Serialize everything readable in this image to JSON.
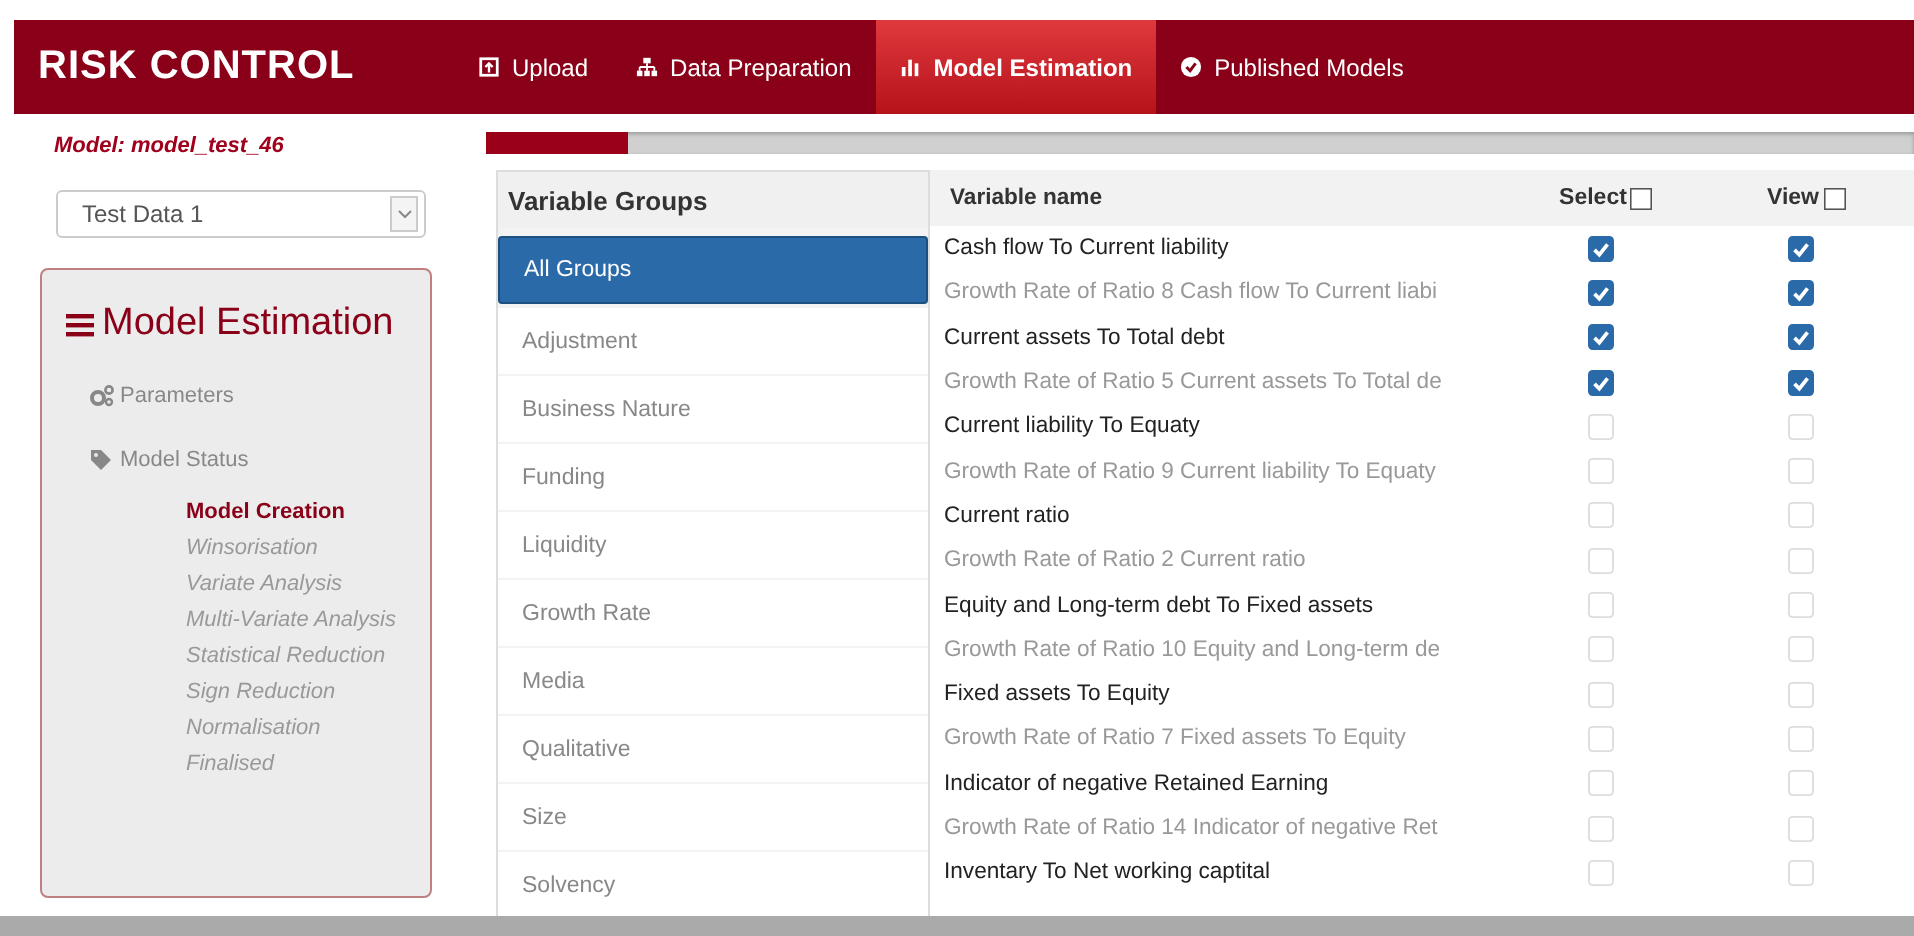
{
  "app_title": "RISK CONTROL",
  "nav": [
    {
      "label": "Upload",
      "selected": false
    },
    {
      "label": "Data Preparation",
      "selected": false
    },
    {
      "label": "Model Estimation",
      "selected": true
    },
    {
      "label": "Published Models",
      "selected": false
    }
  ],
  "model_label": "Model: model_test_46",
  "dataset_select": {
    "value": "Test Data 1"
  },
  "side_panel": {
    "title": "Model Estimation",
    "links": [
      {
        "label": "Parameters"
      },
      {
        "label": "Model Status"
      }
    ],
    "steps": [
      {
        "label": "Model Creation",
        "selected": true
      },
      {
        "label": "Winsorisation",
        "selected": false
      },
      {
        "label": "Variate Analysis",
        "selected": false
      },
      {
        "label": "Multi-Variate Analysis",
        "selected": false
      },
      {
        "label": "Statistical Reduction",
        "selected": false
      },
      {
        "label": "Sign Reduction",
        "selected": false
      },
      {
        "label": "Normalisation",
        "selected": false
      },
      {
        "label": "Finalised",
        "selected": false
      }
    ]
  },
  "progress": {
    "level": 0.1
  },
  "variable_groups": {
    "title": "Variable Groups",
    "items": [
      {
        "label": "All Groups",
        "selected": true
      },
      {
        "label": "Adjustment",
        "selected": false
      },
      {
        "label": "Business Nature",
        "selected": false
      },
      {
        "label": "Funding",
        "selected": false
      },
      {
        "label": "Liquidity",
        "selected": false
      },
      {
        "label": "Growth Rate",
        "selected": false
      },
      {
        "label": "Media",
        "selected": false
      },
      {
        "label": "Qualitative",
        "selected": false
      },
      {
        "label": "Size",
        "selected": false
      },
      {
        "label": "Solvency",
        "selected": false
      }
    ]
  },
  "table": {
    "columns": [
      {
        "label": "Variable name"
      },
      {
        "label": "Select",
        "checked": false
      },
      {
        "label": "View",
        "checked": false
      }
    ],
    "rows": [
      {
        "name": "Cash flow To Current liability",
        "kind": "ratio",
        "select": true,
        "view": true
      },
      {
        "name": "Growth Rate of Ratio 8 Cash flow To Current liabi",
        "kind": "growth",
        "select": true,
        "view": true
      },
      {
        "name": "Current assets To Total debt",
        "kind": "ratio",
        "select": true,
        "view": true
      },
      {
        "name": "Growth Rate of Ratio 5 Current assets To Total de",
        "kind": "growth",
        "select": true,
        "view": true
      },
      {
        "name": "Current liability To Equaty",
        "kind": "ratio",
        "select": false,
        "view": false
      },
      {
        "name": "Growth Rate of Ratio 9 Current liability To Equaty",
        "kind": "growth",
        "select": false,
        "view": false
      },
      {
        "name": "Current ratio",
        "kind": "ratio",
        "select": false,
        "view": false
      },
      {
        "name": "Growth Rate of Ratio 2 Current ratio",
        "kind": "growth",
        "select": false,
        "view": false
      },
      {
        "name": "Equity and Long-term debt To Fixed assets",
        "kind": "ratio",
        "select": false,
        "view": false
      },
      {
        "name": "Growth Rate of Ratio 10 Equity and Long-term de",
        "kind": "growth",
        "select": false,
        "view": false
      },
      {
        "name": "Fixed assets To Equity",
        "kind": "ratio",
        "select": false,
        "view": false
      },
      {
        "name": "Growth Rate of Ratio 7 Fixed assets To Equity",
        "kind": "growth",
        "select": false,
        "view": false
      },
      {
        "name": "Indicator of negative Retained Earning",
        "kind": "ratio",
        "select": false,
        "view": false
      },
      {
        "name": "Growth Rate of Ratio 14 Indicator of negative Ret",
        "kind": "growth",
        "select": false,
        "view": false
      },
      {
        "name": "Inventary To Net working captital",
        "kind": "ratio",
        "select": false,
        "view": false
      }
    ]
  }
}
